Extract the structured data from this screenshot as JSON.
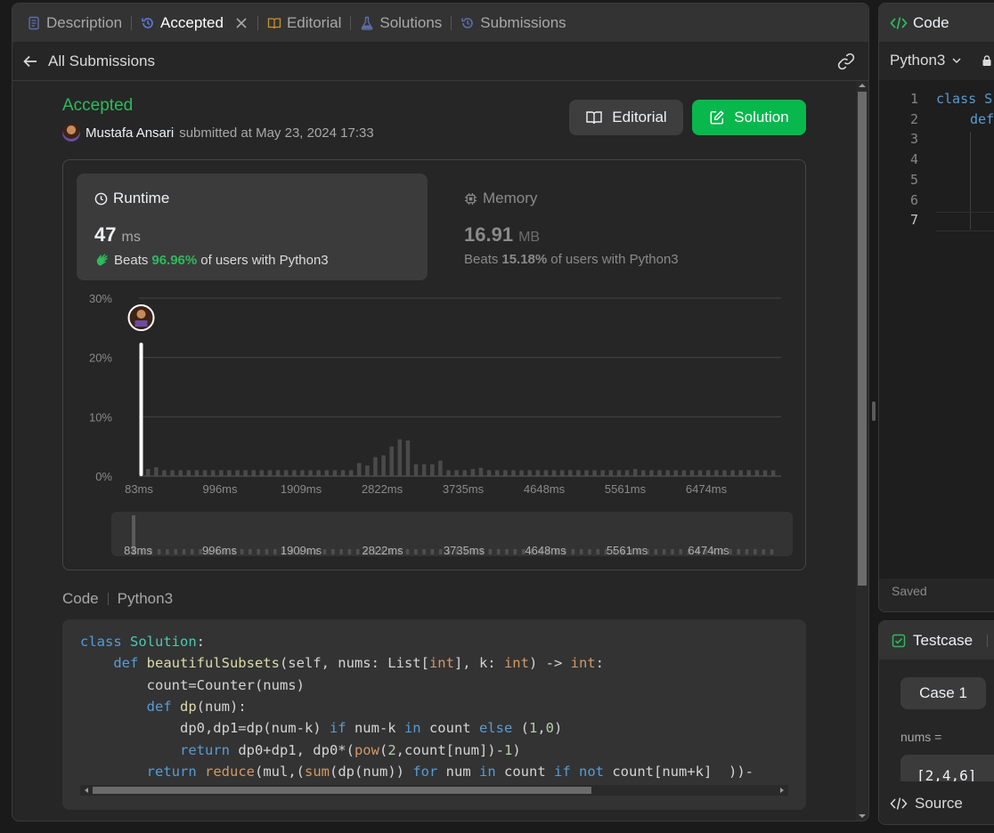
{
  "tabs": [
    {
      "label": "Description",
      "icon": "description-icon"
    },
    {
      "label": "Accepted",
      "icon": "history-icon"
    },
    {
      "label": "Editorial",
      "icon": "book-icon"
    },
    {
      "label": "Solutions",
      "icon": "flask-icon"
    },
    {
      "label": "Submissions",
      "icon": "history-icon"
    }
  ],
  "subheader": {
    "back_label": "All Submissions"
  },
  "submission": {
    "status": "Accepted",
    "user": "Mustafa Ansari",
    "submitted_text": "submitted at May 23, 2024 17:33",
    "editorial_btn": "Editorial",
    "solution_btn": "Solution"
  },
  "runtime": {
    "title": "Runtime",
    "value": "47",
    "unit": "ms",
    "beats_prefix": "Beats",
    "beats_pct": "96.96%",
    "beats_suffix": "of users with Python3"
  },
  "memory": {
    "title": "Memory",
    "value": "16.91",
    "unit": "MB",
    "beats_prefix": "Beats",
    "beats_pct": "15.18%",
    "beats_suffix": "of users with Python3"
  },
  "chart_data": {
    "type": "bar",
    "x_ticks": [
      "83ms",
      "996ms",
      "1909ms",
      "2822ms",
      "3735ms",
      "4648ms",
      "5561ms",
      "6474ms"
    ],
    "y_ticks": [
      "30%",
      "20%",
      "10%",
      "0%"
    ],
    "ylim": [
      0,
      30
    ],
    "highlight_value": 22.5,
    "values": [
      1.2,
      1.5,
      1,
      1,
      1,
      1,
      1,
      1,
      1,
      1,
      1,
      1,
      1,
      1,
      1,
      1,
      1,
      1,
      1,
      1,
      1,
      1,
      1,
      1,
      1,
      1,
      2.2,
      1.8,
      3.2,
      3.5,
      5,
      6.2,
      6,
      2,
      2,
      2,
      2.6,
      1,
      1,
      1,
      1.2,
      1.4,
      1,
      1,
      1,
      1,
      1,
      1,
      1,
      1,
      1,
      1,
      1,
      1,
      1,
      1,
      1,
      1,
      1,
      1,
      1.2,
      1,
      1,
      1,
      1,
      1,
      1,
      1,
      1,
      1,
      1,
      1,
      1,
      1,
      1,
      1,
      1,
      1
    ],
    "mini_ticks": [
      "83ms",
      "996ms",
      "1909ms",
      "2822ms",
      "3735ms",
      "4648ms",
      "5561ms",
      "6474ms"
    ]
  },
  "code_section": {
    "label": "Code",
    "lang": "Python3"
  },
  "code_lines": [
    [
      {
        "t": "class ",
        "c": "kw"
      },
      {
        "t": "Solution",
        "c": "cls"
      },
      {
        "t": ":",
        "c": ""
      }
    ],
    [
      {
        "t": "    ",
        "c": ""
      },
      {
        "t": "def ",
        "c": "kw"
      },
      {
        "t": "beautifulSubsets",
        "c": "fn"
      },
      {
        "t": "(self, nums: List[",
        "c": ""
      },
      {
        "t": "int",
        "c": "bi"
      },
      {
        "t": "], k: ",
        "c": ""
      },
      {
        "t": "int",
        "c": "bi"
      },
      {
        "t": ") -> ",
        "c": ""
      },
      {
        "t": "int",
        "c": "bi"
      },
      {
        "t": ":",
        "c": ""
      }
    ],
    [
      {
        "t": "        count=Counter(nums)",
        "c": ""
      }
    ],
    [
      {
        "t": "        ",
        "c": ""
      },
      {
        "t": "def ",
        "c": "kw"
      },
      {
        "t": "dp",
        "c": "fn"
      },
      {
        "t": "(num):",
        "c": ""
      }
    ],
    [
      {
        "t": "            dp0,dp1=dp(num-k) ",
        "c": ""
      },
      {
        "t": "if",
        "c": "kw"
      },
      {
        "t": " num-k ",
        "c": ""
      },
      {
        "t": "in",
        "c": "kw"
      },
      {
        "t": " count ",
        "c": ""
      },
      {
        "t": "else",
        "c": "kw"
      },
      {
        "t": " (",
        "c": ""
      },
      {
        "t": "1",
        "c": "num-c"
      },
      {
        "t": ",",
        "c": ""
      },
      {
        "t": "0",
        "c": "num-c"
      },
      {
        "t": ")",
        "c": ""
      }
    ],
    [
      {
        "t": "            ",
        "c": ""
      },
      {
        "t": "return",
        "c": "kw"
      },
      {
        "t": " dp0+dp1, dp0*(",
        "c": ""
      },
      {
        "t": "pow",
        "c": "bi"
      },
      {
        "t": "(",
        "c": ""
      },
      {
        "t": "2",
        "c": "num-c"
      },
      {
        "t": ",count[num])-",
        "c": ""
      },
      {
        "t": "1",
        "c": "num-c"
      },
      {
        "t": ")",
        "c": ""
      }
    ],
    [
      {
        "t": "        ",
        "c": ""
      },
      {
        "t": "return",
        "c": "kw"
      },
      {
        "t": " ",
        "c": ""
      },
      {
        "t": "reduce",
        "c": "bi"
      },
      {
        "t": "(mul,(",
        "c": ""
      },
      {
        "t": "sum",
        "c": "bi"
      },
      {
        "t": "(dp(num)) ",
        "c": ""
      },
      {
        "t": "for",
        "c": "kw"
      },
      {
        "t": " num ",
        "c": ""
      },
      {
        "t": "in",
        "c": "kw"
      },
      {
        "t": " count ",
        "c": ""
      },
      {
        "t": "if",
        "c": "kw"
      },
      {
        "t": " ",
        "c": ""
      },
      {
        "t": "not",
        "c": "kw"
      },
      {
        "t": " count[num+k]  ))-",
        "c": ""
      }
    ]
  ],
  "right_code": {
    "title": "Code",
    "lang": "Python3",
    "line_numbers": [
      "1",
      "2",
      "3",
      "4",
      "5",
      "6",
      "7"
    ],
    "line1": "class S",
    "line2": "def",
    "saved": "Saved"
  },
  "testcase": {
    "title": "Testcase",
    "case": "Case 1",
    "nums_label": "nums =",
    "nums_value": "[2,4,6]",
    "source": "Source"
  },
  "colors": {
    "accent_green": "#2cbb5d",
    "button_green": "#08b84d"
  }
}
